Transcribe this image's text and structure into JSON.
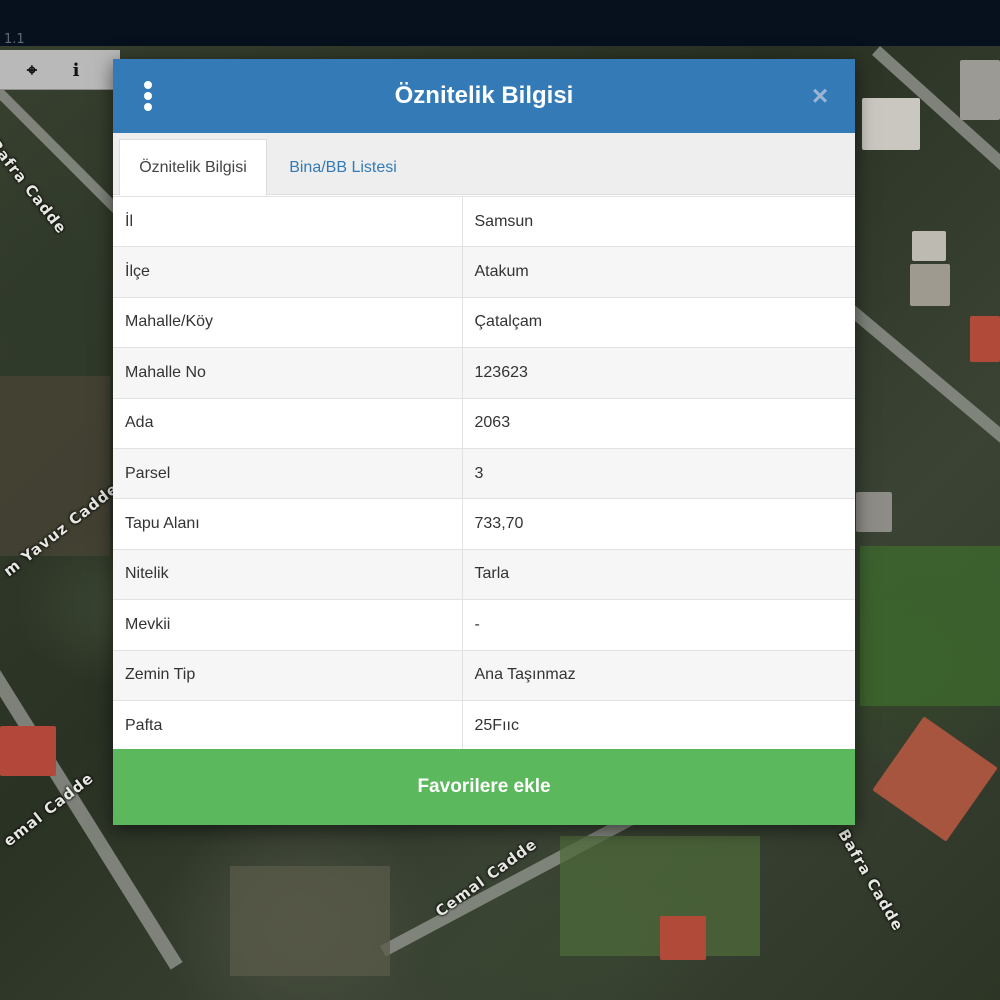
{
  "topbar": {
    "version_text": "1.1"
  },
  "map": {
    "street_labels": [
      "Bafra Cadde",
      "m Yavuz Cadde",
      "emal Cadde",
      "Cemal Cadde",
      "Bafra Cadde"
    ]
  },
  "toolbar": {
    "tools": [
      {
        "icon": "crosshair-icon",
        "glyph": "⌖"
      },
      {
        "icon": "info-icon",
        "glyph": "i"
      }
    ]
  },
  "modal": {
    "title": "Öznitelik Bilgisi",
    "close_glyph": "×",
    "tabs": [
      {
        "label": "Öznitelik Bilgisi",
        "active": true
      },
      {
        "label": "Bina/BB Listesi",
        "active": false
      }
    ],
    "rows": [
      {
        "key": "İl",
        "value": "Samsun"
      },
      {
        "key": "İlçe",
        "value": "Atakum"
      },
      {
        "key": "Mahalle/Köy",
        "value": "Çatalçam"
      },
      {
        "key": "Mahalle No",
        "value": "123623"
      },
      {
        "key": "Ada",
        "value": "2063"
      },
      {
        "key": "Parsel",
        "value": "3"
      },
      {
        "key": "Tapu Alanı",
        "value": "733,70"
      },
      {
        "key": "Nitelik",
        "value": "Tarla"
      },
      {
        "key": "Mevkii",
        "value": "-"
      },
      {
        "key": "Zemin Tip",
        "value": "Ana Taşınmaz"
      },
      {
        "key": "Pafta",
        "value": "25Fııc"
      }
    ],
    "favorite_button_label": "Favorilere ekle"
  },
  "colors": {
    "header": "#337ab7",
    "button": "#5cb85c",
    "topbar": "#07101d"
  }
}
